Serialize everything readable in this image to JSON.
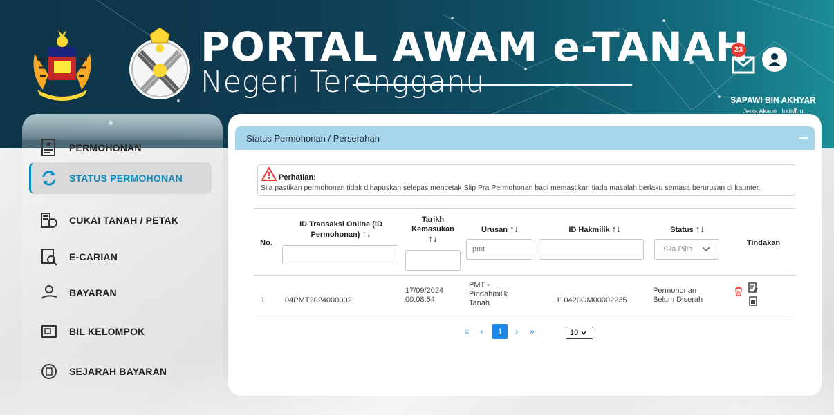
{
  "header": {
    "title": "PORTAL AWAM e-TANAH",
    "subtitle": "Negeri Terengganu",
    "notification_count": "23",
    "user_name": "SAPAWI BIN AKHYAR",
    "account_type": "Jenis Akaun : Individu"
  },
  "sidebar": {
    "items": [
      {
        "label": "PERMOHONAN",
        "icon": "application-form-icon"
      },
      {
        "label": "STATUS PERMOHONAN",
        "icon": "refresh-icon"
      },
      {
        "label": "CUKAI TANAH / PETAK",
        "icon": "land-tax-icon"
      },
      {
        "label": "E-CARIAN",
        "icon": "search-document-icon"
      },
      {
        "label": "BAYARAN",
        "icon": "payment-hand-icon"
      },
      {
        "label": "BIL KELOMPOK",
        "icon": "bulk-bill-icon"
      },
      {
        "label": "SEJARAH BAYARAN",
        "icon": "payment-history-icon"
      }
    ],
    "active_index": 1
  },
  "panel": {
    "title": "Status Permohonan / Perserahan",
    "alert": {
      "title": "Perhatian:",
      "text": "Sila pastikan permohonan tidak dihapuskan selepas mencetak Slip Pra Permohonan bagi memastikan tiada masalah berlaku semasa berurusan di kaunter."
    },
    "table": {
      "headers": {
        "no": "No.",
        "id_transaksi_1": "ID Transaksi Online (ID",
        "id_transaksi_2": "Permohonan)",
        "tarikh_1": "Tarikh",
        "tarikh_2": "Kemasukan",
        "urusan": "Urusan",
        "id_hakmilik": "ID Hakmilik",
        "status": "Status",
        "tindakan": "Tindakan"
      },
      "sort_symbol": "↑↓",
      "filters": {
        "urusan_value": "pmt",
        "status_select": "Sila Pilih"
      },
      "rows": [
        {
          "no": "1",
          "id_transaksi": "04PMT2024000002",
          "tarikh_1": "17/09/2024",
          "tarikh_2": "00:08:54",
          "urusan_1": "PMT -",
          "urusan_2": "Pindahmilik",
          "urusan_3": "Tanah",
          "id_hakmilik": "110420GM00002235",
          "status_1": "Permohonan",
          "status_2": "Belum Diserah"
        }
      ]
    },
    "pagination": {
      "first": "«",
      "prev": "‹",
      "current": "1",
      "next": "›",
      "last": "»",
      "page_size": "10"
    }
  },
  "colors": {
    "accent": "#0a8bbf",
    "panel_header": "#a6d5ea",
    "delete": "#e53935",
    "page_active": "#1e88e5"
  }
}
